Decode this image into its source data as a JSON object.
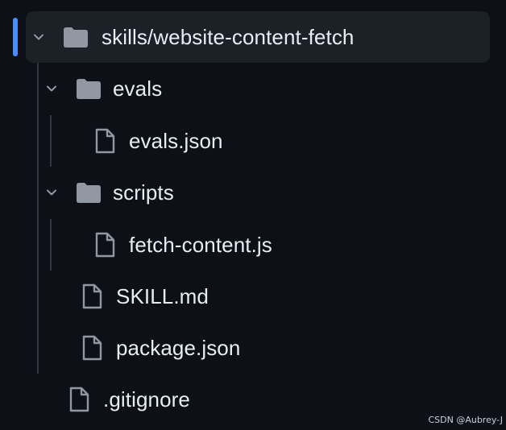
{
  "tree": {
    "root": {
      "label": "skills/website-content-fetch",
      "icon": "folder-icon",
      "expanded": true
    },
    "items": [
      {
        "label": "evals",
        "icon": "folder-icon",
        "expanded": true
      },
      {
        "label": "evals.json",
        "icon": "file-icon"
      },
      {
        "label": "scripts",
        "icon": "folder-icon",
        "expanded": true
      },
      {
        "label": "fetch-content.js",
        "icon": "file-icon"
      },
      {
        "label": "SKILL.md",
        "icon": "file-icon"
      },
      {
        "label": "package.json",
        "icon": "file-icon"
      },
      {
        "label": ".gitignore",
        "icon": "file-icon"
      }
    ]
  },
  "colors": {
    "background": "#0d1117",
    "selected_row": "#1c2128",
    "accent": "#4c8cf5",
    "icon": "#9198a1",
    "text": "#e6edf3",
    "guide": "#30363d"
  },
  "watermark": "CSDN @Aubrey-J"
}
